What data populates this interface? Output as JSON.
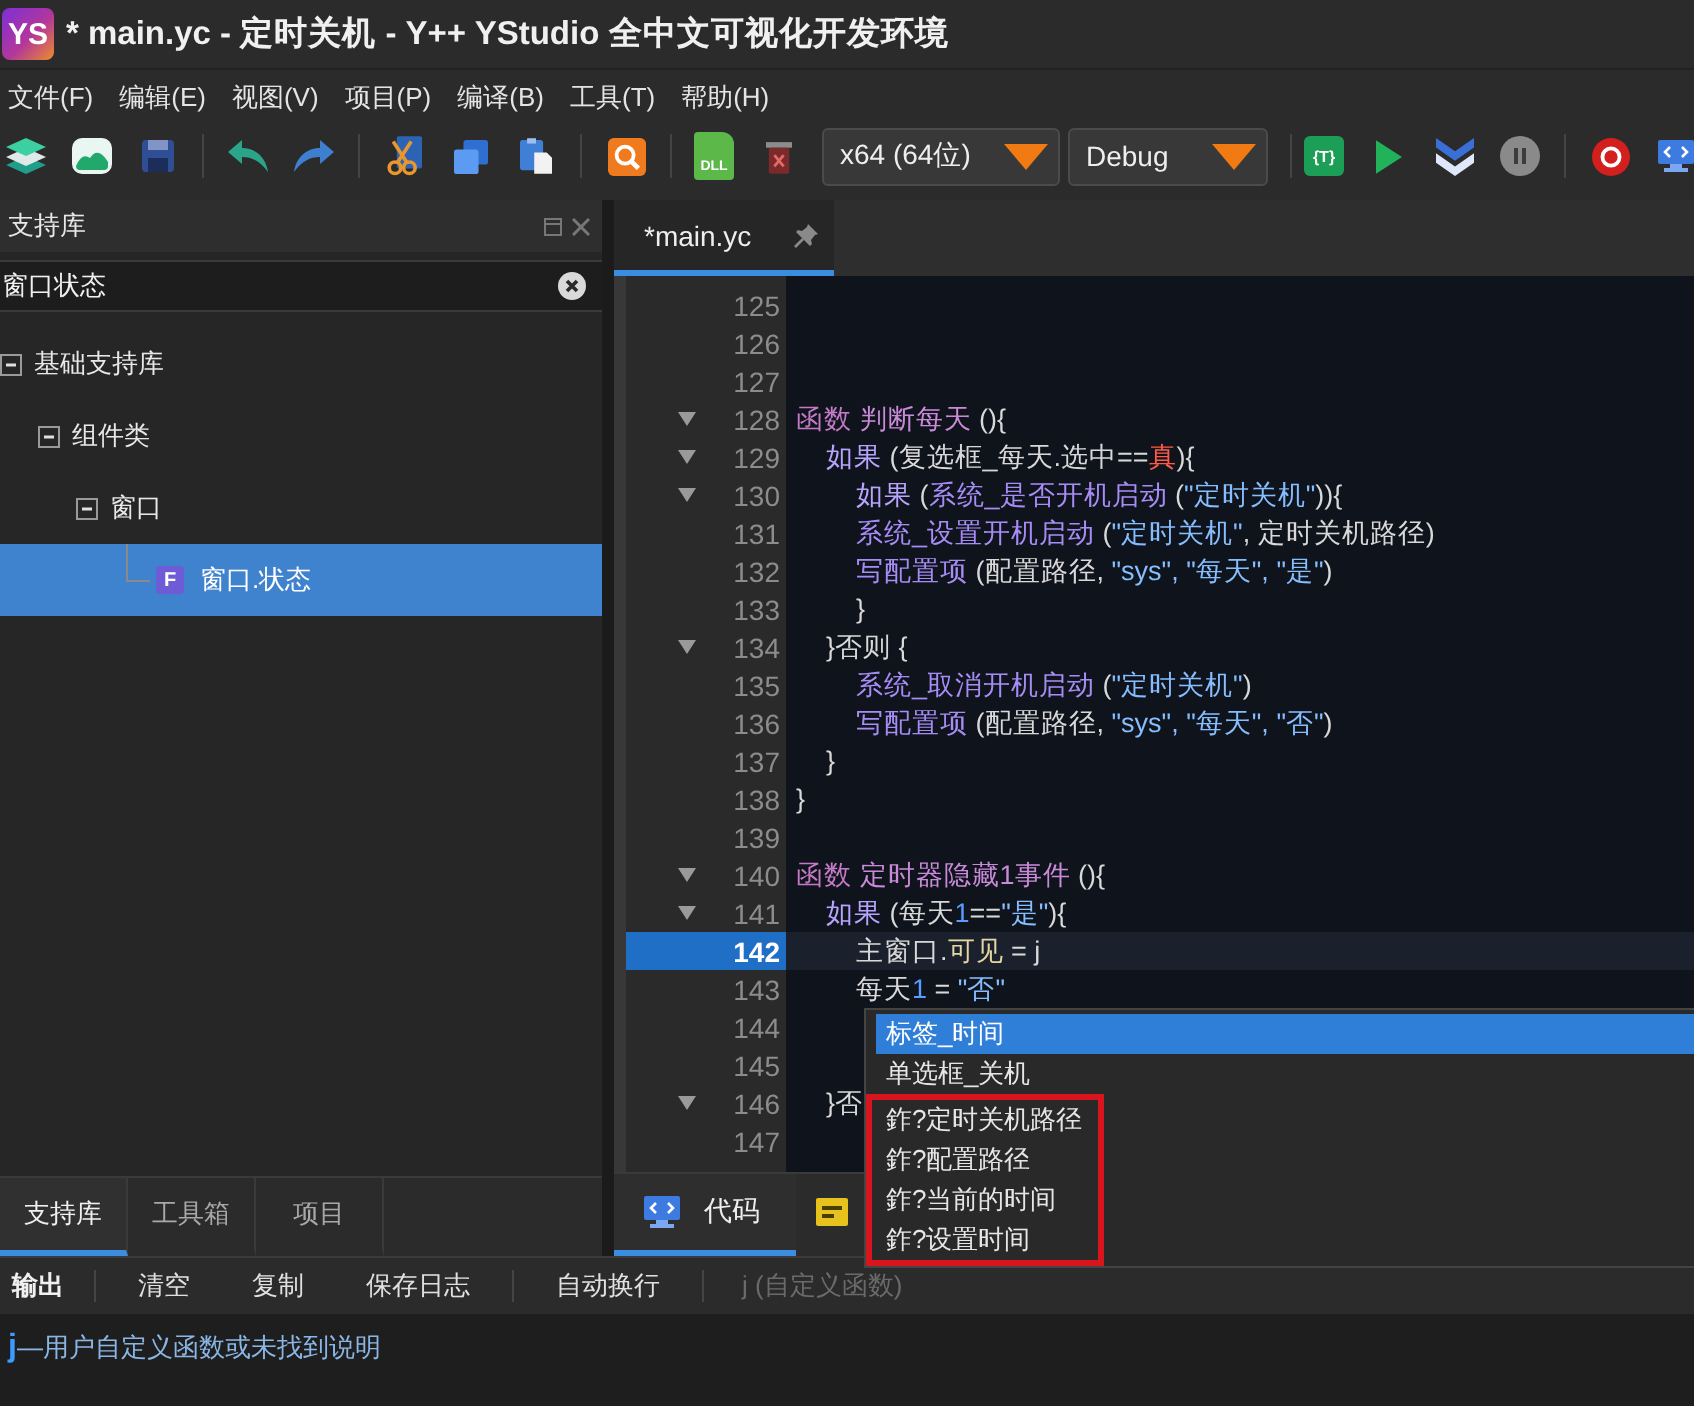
{
  "window": {
    "logo": "YS",
    "title": "* main.yc - 定时关机 - Y++ YStudio 全中文可视化开发环境"
  },
  "menu": [
    "文件(F)",
    "编辑(E)",
    "视图(V)",
    "项目(P)",
    "编译(B)",
    "工具(T)",
    "帮助(H)"
  ],
  "toolbar": {
    "dll": "DLL",
    "platform": "x64 (64位)",
    "configuration": "Debug",
    "template": "{T}"
  },
  "left_panel": {
    "title": "支持库",
    "search": {
      "value": "窗口状态"
    },
    "tree": [
      {
        "label": "基础支持库",
        "expanded": true,
        "selected": false,
        "children": [
          {
            "label": "组件类",
            "expanded": true,
            "selected": false,
            "children": [
              {
                "label": "窗口",
                "expanded": true,
                "selected": false,
                "children": [
                  {
                    "label": "窗口.状态",
                    "badge": "F",
                    "selected": true
                  }
                ]
              }
            ]
          }
        ]
      }
    ],
    "tabs": [
      {
        "label": "支持库",
        "selected": true
      },
      {
        "label": "工具箱",
        "selected": false
      },
      {
        "label": "项目",
        "selected": false
      }
    ]
  },
  "editor": {
    "tabs": [
      {
        "label": "*main.yc",
        "selected": true
      }
    ],
    "lines": [
      {
        "number": "125",
        "fold": false,
        "current": false
      },
      {
        "number": "126",
        "fold": false,
        "current": false
      },
      {
        "number": "127",
        "fold": false,
        "current": false
      },
      {
        "number": "128",
        "fold": true,
        "current": false,
        "tokens": [
          {
            "kind": "keyword",
            "text": "函数 "
          },
          {
            "kind": "name",
            "text": "判断每天"
          },
          {
            "kind": "plain",
            "text": " (){"
          }
        ]
      },
      {
        "number": "129",
        "fold": true,
        "current": false,
        "tokens": [
          {
            "kind": "control",
            "text": "    如果"
          },
          {
            "kind": "plain",
            "text": " (复选框_每天.选中=="
          },
          {
            "kind": "constant",
            "text": "真"
          },
          {
            "kind": "plain",
            "text": "){"
          }
        ]
      },
      {
        "number": "130",
        "fold": true,
        "current": false,
        "tokens": [
          {
            "kind": "control",
            "text": "        如果"
          },
          {
            "kind": "plain",
            "text": " ("
          },
          {
            "kind": "func",
            "text": "系统_是否开机启动"
          },
          {
            "kind": "plain",
            "text": " ("
          },
          {
            "kind": "string",
            "text": "\"定时关机\""
          },
          {
            "kind": "plain",
            "text": ")){"
          }
        ]
      },
      {
        "number": "131",
        "fold": false,
        "current": false,
        "tokens": [
          {
            "kind": "func",
            "text": "        系统_设置开机启动"
          },
          {
            "kind": "plain",
            "text": " ("
          },
          {
            "kind": "string",
            "text": "\"定时关机\""
          },
          {
            "kind": "plain",
            "text": ", 定时关机路径)"
          }
        ]
      },
      {
        "number": "132",
        "fold": false,
        "current": false,
        "tokens": [
          {
            "kind": "func",
            "text": "        写配置项"
          },
          {
            "kind": "plain",
            "text": " (配置路径, "
          },
          {
            "kind": "string",
            "text": "\"sys\", \"每天\", \"是\""
          },
          {
            "kind": "plain",
            "text": ")"
          }
        ]
      },
      {
        "number": "133",
        "fold": false,
        "current": false,
        "tokens": [
          {
            "kind": "plain",
            "text": "        }"
          }
        ]
      },
      {
        "number": "134",
        "fold": true,
        "current": false,
        "tokens": [
          {
            "kind": "plain",
            "text": "    }否则 {"
          }
        ]
      },
      {
        "number": "135",
        "fold": false,
        "current": false,
        "tokens": [
          {
            "kind": "func",
            "text": "        系统_取消开机启动"
          },
          {
            "kind": "plain",
            "text": " ("
          },
          {
            "kind": "string",
            "text": "\"定时关机\""
          },
          {
            "kind": "plain",
            "text": ")"
          }
        ]
      },
      {
        "number": "136",
        "fold": false,
        "current": false,
        "tokens": [
          {
            "kind": "func",
            "text": "        写配置项"
          },
          {
            "kind": "plain",
            "text": " (配置路径, "
          },
          {
            "kind": "string",
            "text": "\"sys\", \"每天\", \"否\""
          },
          {
            "kind": "plain",
            "text": ")"
          }
        ]
      },
      {
        "number": "137",
        "fold": false,
        "current": false,
        "tokens": [
          {
            "kind": "plain",
            "text": "    }"
          }
        ]
      },
      {
        "number": "138",
        "fold": false,
        "current": false,
        "tokens": [
          {
            "kind": "plain",
            "text": "}"
          }
        ]
      },
      {
        "number": "139",
        "fold": false,
        "current": false
      },
      {
        "number": "140",
        "fold": true,
        "current": false,
        "tokens": [
          {
            "kind": "keyword",
            "text": "函数 "
          },
          {
            "kind": "name",
            "text": "定时器隐藏1事件"
          },
          {
            "kind": "plain",
            "text": " (){"
          }
        ]
      },
      {
        "number": "141",
        "fold": true,
        "current": false,
        "tokens": [
          {
            "kind": "control",
            "text": "    如果"
          },
          {
            "kind": "plain",
            "text": " (每天"
          },
          {
            "kind": "number",
            "text": "1"
          },
          {
            "kind": "plain",
            "text": "=="
          },
          {
            "kind": "string",
            "text": "\"是\""
          },
          {
            "kind": "plain",
            "text": "){"
          }
        ]
      },
      {
        "number": "142",
        "fold": false,
        "current": true,
        "tokens": [
          {
            "kind": "plain",
            "text": "        主窗口."
          },
          {
            "kind": "property",
            "text": "可见"
          },
          {
            "kind": "plain",
            "text": " = j"
          }
        ]
      },
      {
        "number": "143",
        "fold": false,
        "current": false,
        "tokens": [
          {
            "kind": "plain",
            "text": "        每天"
          },
          {
            "kind": "number",
            "text": "1"
          },
          {
            "kind": "plain",
            "text": " = "
          },
          {
            "kind": "string",
            "text": "\"否\""
          }
        ]
      },
      {
        "number": "144",
        "fold": false,
        "current": false
      },
      {
        "number": "145",
        "fold": false,
        "current": false
      },
      {
        "number": "146",
        "fold": true,
        "current": false,
        "tokens": [
          {
            "kind": "plain",
            "text": "    }否"
          }
        ]
      },
      {
        "number": "147",
        "fold": false,
        "current": false
      }
    ],
    "bottom_tabs": [
      {
        "kind": "code",
        "label": "代码",
        "selected": true
      },
      {
        "kind": "designer",
        "selected": false
      }
    ]
  },
  "autocomplete": {
    "items": [
      {
        "label": "标签_时间",
        "selected": true,
        "marked": false
      },
      {
        "label": "单选框_关机",
        "selected": false,
        "marked": false
      },
      {
        "label": "鈼?定时关机路径",
        "selected": false,
        "marked": true
      },
      {
        "label": "鈼?配置路径",
        "selected": false,
        "marked": true
      },
      {
        "label": "鈼?当前的时间",
        "selected": false,
        "marked": true
      },
      {
        "label": "鈼?设置时间",
        "selected": false,
        "marked": true
      }
    ]
  },
  "output": {
    "toolbar": [
      {
        "kind": "title",
        "label": "输出"
      },
      {
        "kind": "separator"
      },
      {
        "kind": "button",
        "label": "清空"
      },
      {
        "kind": "button",
        "label": "复制"
      },
      {
        "kind": "button",
        "label": "保存日志"
      },
      {
        "kind": "separator"
      },
      {
        "kind": "button",
        "label": "自动换行"
      },
      {
        "kind": "separator"
      },
      {
        "kind": "hint",
        "label": "j (自定义函数)"
      }
    ],
    "lines": [
      {
        "term": "j",
        "text": "—用户自定义函数或未找到说明"
      }
    ]
  }
}
